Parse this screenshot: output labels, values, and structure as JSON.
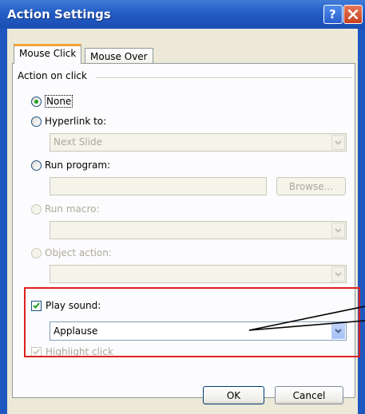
{
  "window": {
    "title": "Action Settings"
  },
  "tabs": [
    {
      "label": "Mouse Click",
      "active": true
    },
    {
      "label": "Mouse Over",
      "active": false
    }
  ],
  "group": {
    "label": "Action on click"
  },
  "options": {
    "none": {
      "label": "None",
      "checked": true
    },
    "hyperlink": {
      "label": "Hyperlink to:",
      "value": "Next Slide"
    },
    "run_program": {
      "label": "Run program:",
      "value": "",
      "browse_label": "Browse..."
    },
    "run_macro": {
      "label": "Run macro:",
      "value": ""
    },
    "object_action": {
      "label": "Object action:",
      "value": ""
    }
  },
  "sound": {
    "label": "Play sound:",
    "checked": true,
    "value": "Applause"
  },
  "highlight": {
    "label": "Highlight click",
    "checked": true
  },
  "buttons": {
    "ok": "OK",
    "cancel": "Cancel"
  },
  "colors": {
    "title_bar": "#245cc4",
    "dialog_bg": "#ece9d8",
    "annotation": "#e02020",
    "radio_dot": "#21a121"
  }
}
